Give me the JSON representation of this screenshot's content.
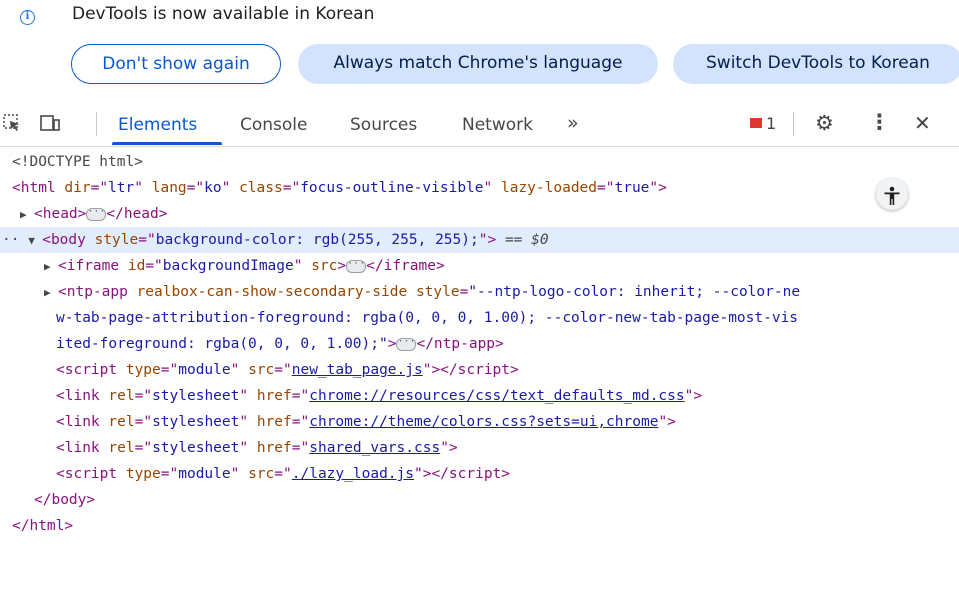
{
  "infobar": {
    "message": "DevTools is now available in Korean",
    "buttons": {
      "dont_show": "Don't show again",
      "always_match": "Always match Chrome's language",
      "switch": "Switch DevTools to Korean"
    }
  },
  "toolbar": {
    "tabs": [
      "Elements",
      "Console",
      "Sources",
      "Network"
    ],
    "more_tabs": "»",
    "issues_count": "1"
  },
  "dom": {
    "doctype": "<!DOCTYPE html>",
    "html_open": {
      "tag": "html",
      "attrs": [
        [
          "dir",
          "ltr"
        ],
        [
          "lang",
          "ko"
        ],
        [
          "class",
          "focus-outline-visible"
        ],
        [
          "lazy-loaded",
          "true"
        ]
      ]
    },
    "head": {
      "open": "<head>",
      "close": "</head>"
    },
    "body_open": {
      "tag": "body",
      "attr": "style",
      "value": "background-color: rgb(255, 255, 255);",
      "eq": "== $0"
    },
    "iframe": {
      "tag": "iframe",
      "id_attr": "id",
      "id_val": "backgroundImage",
      "src_attr": "src",
      "close": "</iframe>"
    },
    "ntp_app": {
      "open_tag": "ntp-app",
      "attr1": "realbox-can-show-secondary-side",
      "style_attr": "style",
      "line1": "\"--ntp-logo-color: inherit; --color-ne",
      "line2": "w-tab-page-attribution-foreground: rgba(0, 0, 0, 1.00); --color-new-tab-page-most-vis",
      "line3": "ited-foreground: rgba(0, 0, 0, 1.00);\"",
      "close": "</ntp-app>"
    },
    "script1": {
      "type_attr": "type",
      "type_val": "module",
      "src_attr": "src",
      "src_val": "new_tab_page.js"
    },
    "link1": {
      "rel_attr": "rel",
      "rel_val": "stylesheet",
      "href_attr": "href",
      "href_val": "chrome://resources/css/text_defaults_md.css"
    },
    "link2": {
      "rel_attr": "rel",
      "rel_val": "stylesheet",
      "href_attr": "href",
      "href_val": "chrome://theme/colors.css?sets=ui,chrome"
    },
    "link3": {
      "rel_attr": "rel",
      "rel_val": "stylesheet",
      "href_attr": "href",
      "href_val": "shared_vars.css"
    },
    "script2": {
      "type_attr": "type",
      "type_val": "module",
      "src_attr": "src",
      "src_val": "./lazy_load.js"
    },
    "body_close": "</body>",
    "html_close": "</html>"
  },
  "icons": {
    "info": "info-icon",
    "inspect": "inspect-element-icon",
    "device": "device-toggle-icon",
    "issues": "issues-flag-icon",
    "settings": "gear-icon",
    "menu": "kebab-menu-icon",
    "close": "close-icon",
    "accessibility": "accessibility-icon"
  },
  "colors": {
    "accent": "#0b57d0",
    "selected_row": "#e1ecfd",
    "tag": "#881280",
    "attr_name": "#994500",
    "attr_value": "#1a1aa6",
    "issues_red": "#dc362e"
  }
}
